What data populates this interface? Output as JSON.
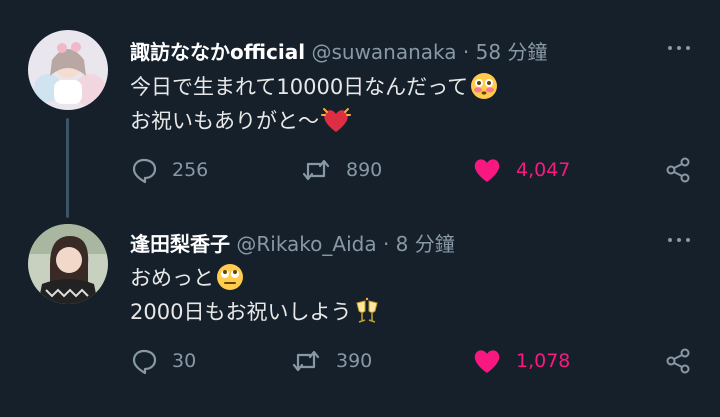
{
  "tweets": [
    {
      "name": "諏訪ななかofficial",
      "handle": "@suwananaka",
      "separator": "·",
      "time": "58 分鐘",
      "lines": [
        "今日で生まれて10000日なんだって",
        "お祝いもありがと〜"
      ],
      "emojis": [
        "flushed-face",
        "beating-heart"
      ],
      "replies": "256",
      "retweets": "890",
      "likes": "4,047",
      "liked": true
    },
    {
      "name": "逢田梨香子",
      "handle": "@Rikako_Aida",
      "separator": "·",
      "time": "8 分鐘",
      "lines": [
        "おめっと",
        "2000日もお祝いしよう"
      ],
      "emojis": [
        "face-with-rolling-eyes",
        "clinking-glasses"
      ],
      "replies": "30",
      "retweets": "390",
      "likes": "1,078",
      "liked": true
    }
  ],
  "colors": {
    "background": "#15202b",
    "like": "#f91880",
    "muted": "#8899a6",
    "thread": "#3d5466"
  }
}
